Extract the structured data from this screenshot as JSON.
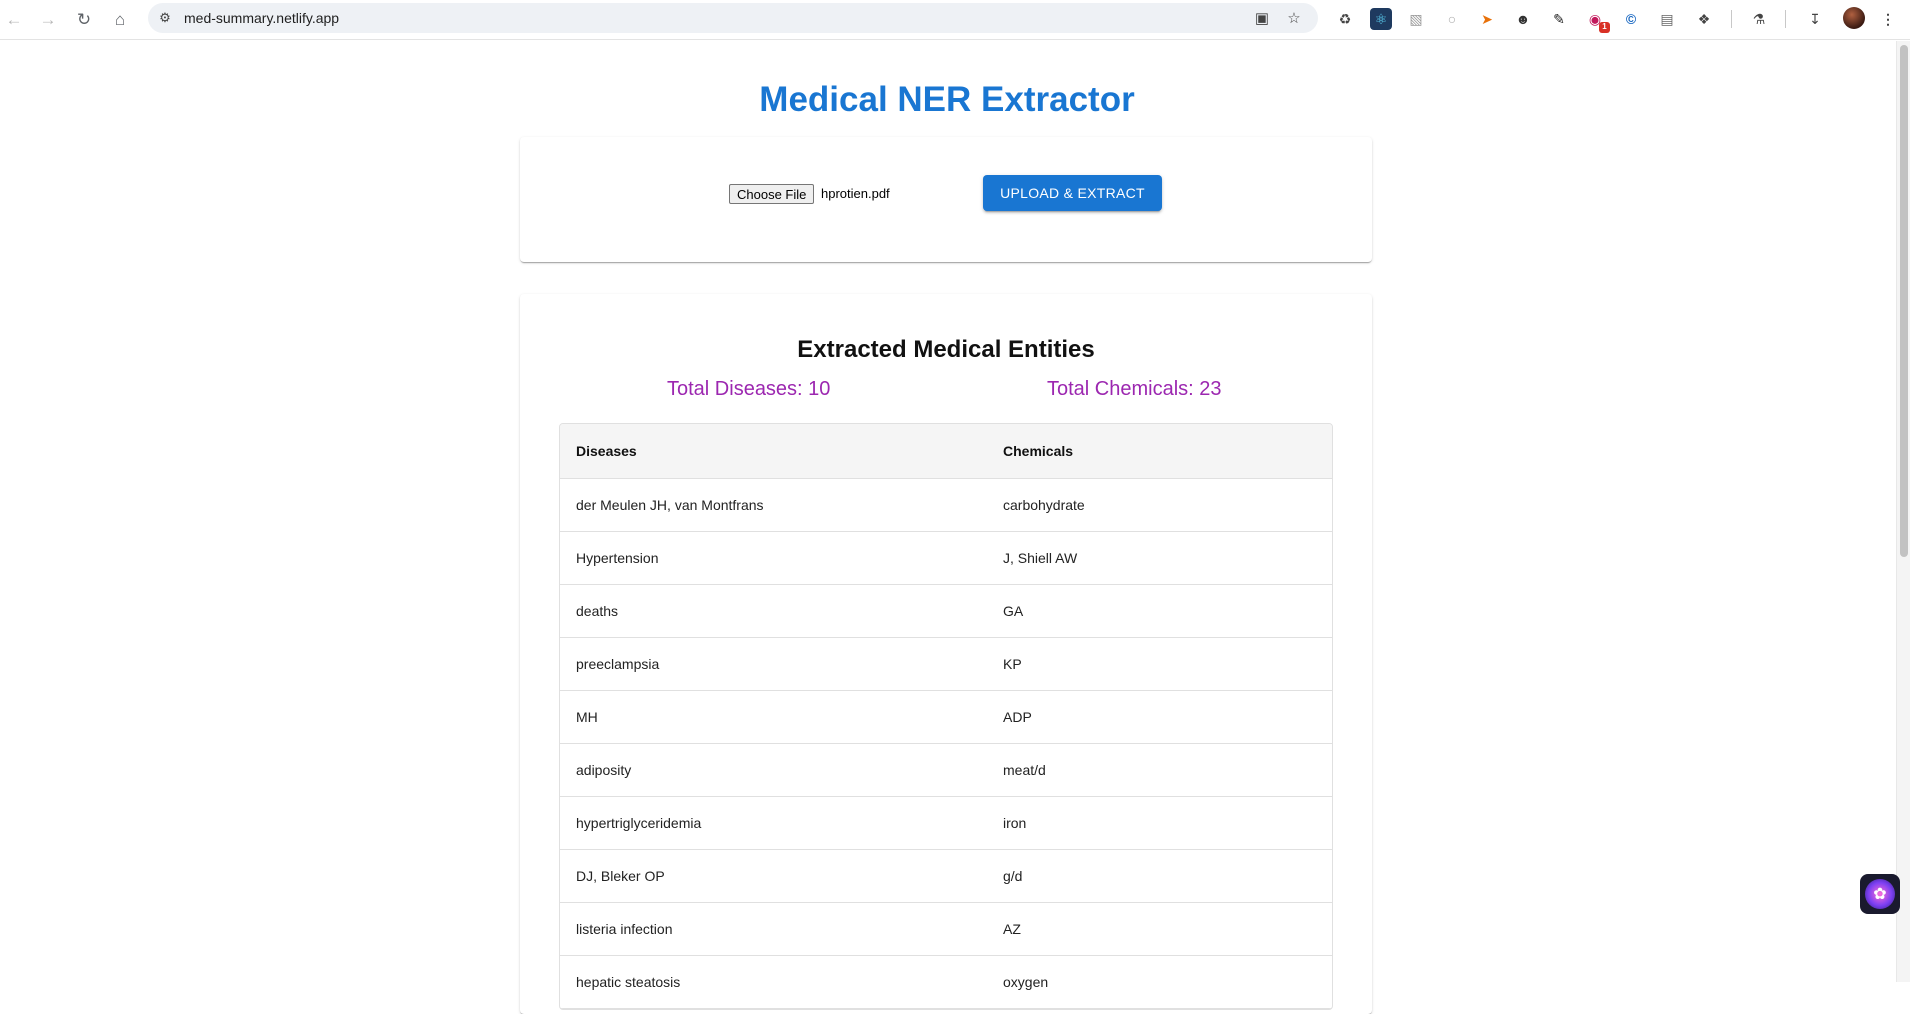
{
  "browser": {
    "url": "med-summary.netlify.app",
    "extension_badge": "1"
  },
  "page": {
    "title": "Medical NER Extractor"
  },
  "upload": {
    "choose_file_label": "Choose File",
    "file_name": "hprotien.pdf",
    "upload_button_label": "UPLOAD & EXTRACT"
  },
  "results": {
    "heading": "Extracted Medical Entities",
    "total_diseases": "Total Diseases: 10",
    "total_chemicals": "Total Chemicals: 23",
    "columns": [
      "Diseases",
      "Chemicals"
    ],
    "rows": [
      [
        "der Meulen JH, van Montfrans",
        "carbohydrate"
      ],
      [
        "Hypertension",
        "J, Shiell AW"
      ],
      [
        "deaths",
        "GA"
      ],
      [
        "preeclampsia",
        "KP"
      ],
      [
        "MH",
        "ADP"
      ],
      [
        "adiposity",
        "meat/d"
      ],
      [
        "hypertriglyceridemia",
        "iron"
      ],
      [
        "DJ, Bleker OP",
        "g/d"
      ],
      [
        "listeria infection",
        "AZ"
      ],
      [
        "hepatic steatosis",
        "oxygen"
      ]
    ]
  },
  "colors": {
    "primary": "#1976d2",
    "totals": "#9c27b0"
  }
}
